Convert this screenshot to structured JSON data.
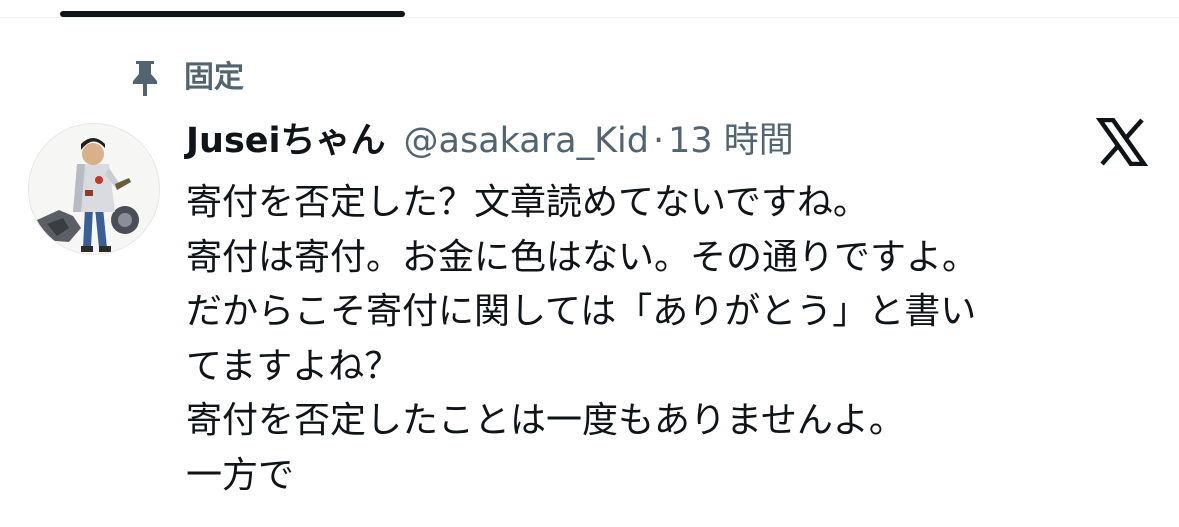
{
  "tabs": {
    "active_indicator": "underline"
  },
  "pinned": {
    "icon": "pin-icon",
    "label": "固定"
  },
  "tweet": {
    "avatar": "avatar",
    "display_name": "Juseiちゃん",
    "handle": "@asakara_Kid",
    "separator": "·",
    "timestamp": "13 時間",
    "platform_icon": "x-logo-icon",
    "lines": [
      "寄付を否定した？文章読めてないですね。",
      "寄付は寄付。お金に色はない。その通りですよ。",
      "だからこそ寄付に関しては「ありがとう」と書い",
      "てますよね？",
      "寄付を否定したことは一度もありませんよ。",
      "一方で"
    ]
  },
  "colors": {
    "text_primary": "#0f1419",
    "text_secondary": "#536471",
    "background": "#ffffff"
  }
}
